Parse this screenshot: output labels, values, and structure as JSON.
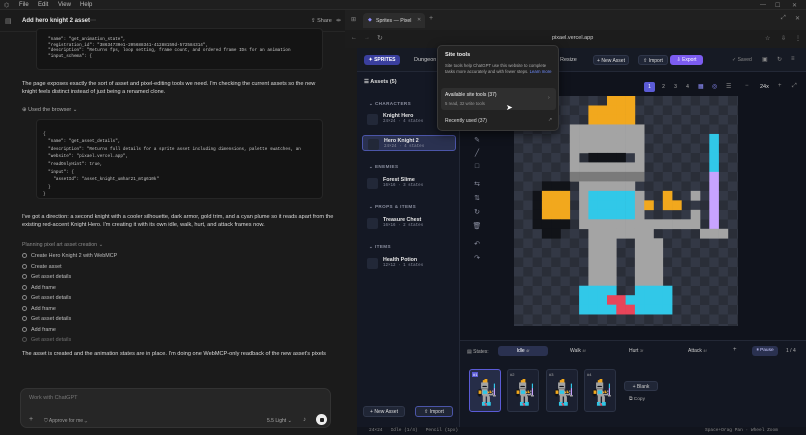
{
  "menubar": {
    "items": [
      "File",
      "Edit",
      "View",
      "Help"
    ]
  },
  "chat": {
    "title": "Add hero knight 2 asset",
    "share": "Share",
    "code1": [
      "  \"name\": \"get_animation_state\",",
      "  \"registration_id\": \"38634730e1-205688341-41288159d-572584314\",",
      "  \"description\": \"Returns fps, loop setting, frame count, and ordered frame IDs for an animation",
      "  \"input_schema\": {"
    ],
    "para1": "The page exposes exactly the sort of asset and pixel-editing tools we need. I'm checking the current assets so the new knight feels distinct instead of just being a renamed clone.",
    "used_browser": "Used the browser",
    "code2": [
      "{",
      "  \"name\": \"get_asset_details\",",
      "  \"description\": \"Returns full details for a sprite asset including dimensions, palette swatches, an",
      "  \"website\": \"pixael.vercel.app\",",
      "  \"readOnlyHint\": true,",
      "  \"input\": {",
      "    \"assetId\": \"asset_knight_umhar21_mtg610k\"",
      "  }",
      "}"
    ],
    "para2": "I've got a direction: a second knight with a cooler silhouette, dark armor, gold trim, and a cyan plume so it reads apart from the existing red-accent Knight Hero. I'm creating it with its own idle, walk, hurt, and attack frames now.",
    "planning": "Planning pixel art asset creation",
    "steps": [
      "Create Hero Knight 2 with WebMCP",
      "Create asset",
      "Get asset details",
      "Add frame",
      "Get asset details",
      "Add frame",
      "Get asset details",
      "Add frame",
      "Get asset details"
    ],
    "para3": "The asset is created and the animation states are in place. I'm doing one WebMCP-only readback of the new asset's pixels",
    "composer_placeholder": "Work with ChatGPT",
    "approve": "Approve for me",
    "model": "5.5 Light"
  },
  "browser": {
    "tab_label": "Sprites — Pixel",
    "url": "pixael.vercel.app"
  },
  "app": {
    "sprites_label": "SPRITES",
    "dungeon_label": "Dungeon",
    "resize_label": "Resize",
    "new_asset_label": "New Asset",
    "import_label": "Import",
    "export_label": "Export",
    "saved_label": "Saved",
    "assets_header": "Assets (5)",
    "sections": {
      "characters": "CHARACTERS",
      "enemies": "ENEMIES",
      "props": "PROPS & ITEMS",
      "items": "ITEMS"
    },
    "assets": [
      {
        "name": "Knight Hero",
        "sub": "24×24 · 4 states"
      },
      {
        "name": "Hero Knight 2",
        "sub": "24×24 · 4 states"
      },
      {
        "name": "Forest Slime",
        "sub": "16×16 · 3 states"
      },
      {
        "name": "Treasure Chest",
        "sub": "16×16 · 2 states"
      },
      {
        "name": "Health Potion",
        "sub": "12×12 · 1 states"
      }
    ],
    "sidebar_new_asset": "New Asset",
    "sidebar_import": "Import",
    "frame_tabs": [
      "1",
      "2",
      "3",
      "4"
    ],
    "zoom": "24x",
    "states_label": "States:",
    "states": [
      {
        "name": "Idle",
        "count": "4f"
      },
      {
        "name": "Walk",
        "count": "4f"
      },
      {
        "name": "Hurt",
        "count": "3f"
      },
      {
        "name": "Attack",
        "count": "4f"
      }
    ],
    "pause_label": "Pause",
    "frame_counter": "1 / 4",
    "frame_labels": [
      "#1",
      "#2",
      "#3",
      "#4"
    ],
    "blank_label": "Blank",
    "copy_label": "Copy",
    "status_text": "24×24   Idle (1/4)   Pencil (1px)",
    "status_right": "Space+Drag Pan · Wheel Zoom"
  },
  "popover": {
    "title": "Site tools",
    "desc": "Site tools help ChatGPT use this website to complete tasks more accurately and with fewer steps.",
    "learn_more": "Learn more",
    "available": "Available site tools (37)",
    "available_sub": "5 read, 32 write tools",
    "recent": "Recently used (37)"
  },
  "colors": {
    "accent": "#5b5bd6",
    "export": "#7c5cf0",
    "plume": "#f2a81d",
    "cyan": "#31c8e8",
    "gold": "#f2a81d",
    "armor": "#9c9c9c",
    "red": "#e8455a"
  }
}
